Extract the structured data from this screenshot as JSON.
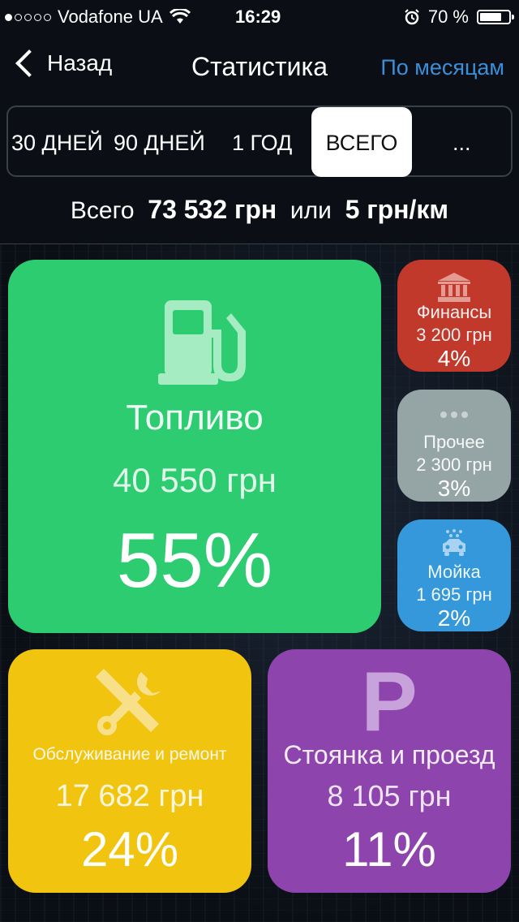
{
  "status_bar": {
    "carrier": "Vodafone UA",
    "time": "16:29",
    "battery": "70 %",
    "signal_bars_filled": 1,
    "signal_bars_total": 5
  },
  "nav": {
    "back_label": "Назад",
    "title": "Статистика",
    "right_label": "По месяцам"
  },
  "periods": {
    "items": [
      "30 ДНЕЙ",
      "90 ДНЕЙ",
      "1 ГОД",
      "ВСЕГО",
      "..."
    ],
    "selected": "ВСЕГО"
  },
  "summary": {
    "prefix": "Всего",
    "total": "73 532 грн",
    "connector": "или",
    "per_km": "5 грн/км"
  },
  "categories": {
    "fuel": {
      "name": "Топливо",
      "amount": "40 550 грн",
      "percent": "55%",
      "icon": "fuel-pump-icon",
      "color": "#2ecc71"
    },
    "finance": {
      "name": "Финансы",
      "amount": "3 200 грн",
      "percent": "4%",
      "icon": "bank-icon",
      "color": "#c0392b"
    },
    "other": {
      "name": "Прочее",
      "amount": "2 300 грн",
      "percent": "3%",
      "icon": "more-dots-icon",
      "color": "#95a5a6"
    },
    "wash": {
      "name": "Мойка",
      "amount": "1 695 грн",
      "percent": "2%",
      "icon": "car-wash-icon",
      "color": "#3498db"
    },
    "service": {
      "name": "Обслуживание и ремонт",
      "amount": "17 682 грн",
      "percent": "24%",
      "icon": "tools-icon",
      "color": "#f1c40f"
    },
    "parking": {
      "name": "Стоянка и проезд",
      "amount": "8 105 грн",
      "percent": "11%",
      "icon": "parking-icon",
      "color": "#8e44ad"
    }
  }
}
